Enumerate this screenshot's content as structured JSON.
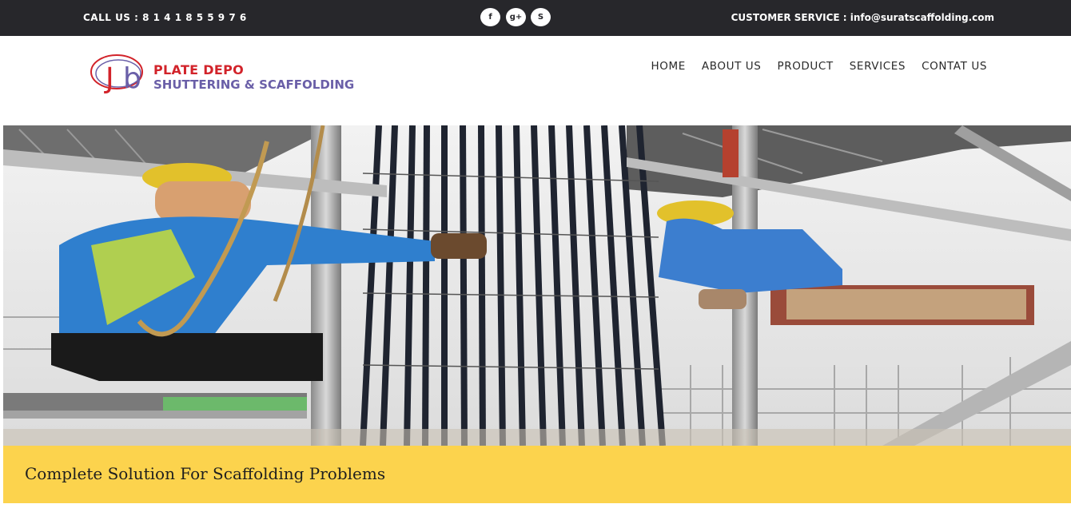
{
  "topbar": {
    "call": "CALL US : 8 1 4 1 8 5 5 9 7 6",
    "service": "CUSTOMER SERVICE : info@suratscaffolding.com",
    "social": [
      {
        "icon": "facebook-icon",
        "glyph": "f"
      },
      {
        "icon": "google-plus-icon",
        "glyph": "g+"
      },
      {
        "icon": "skype-icon",
        "glyph": "S"
      }
    ]
  },
  "logo": {
    "monogram": "Jb",
    "line1": "PLATE DEPO",
    "line2": "SHUTTERING & SCAFFOLDING"
  },
  "nav": [
    "HOME",
    "ABOUT US",
    "PRODUCT",
    "SERVICES",
    "CONTAT US"
  ],
  "hero": {
    "caption": "Complete Solution For Scaffolding Problems"
  },
  "colors": {
    "topbar": "#27272b",
    "logo_red": "#d2232a",
    "logo_purple": "#6a5fa8",
    "caption_bar": "#fcd34d"
  }
}
